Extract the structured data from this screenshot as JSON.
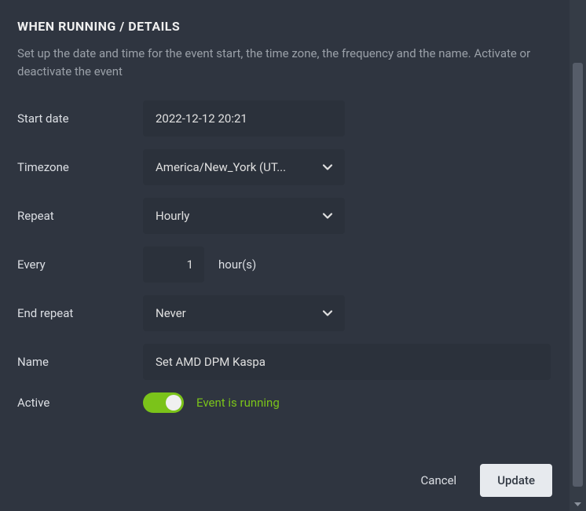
{
  "section": {
    "title": "WHEN RUNNING / DETAILS",
    "description": "Set up the date and time for the event start, the time zone, the frequency and the name. Activate or deactivate the event"
  },
  "form": {
    "start_date": {
      "label": "Start date",
      "value": "2022-12-12 20:21"
    },
    "timezone": {
      "label": "Timezone",
      "value": "America/New_York (UT..."
    },
    "repeat": {
      "label": "Repeat",
      "value": "Hourly"
    },
    "every": {
      "label": "Every",
      "value": "1",
      "suffix": "hour(s)"
    },
    "end_repeat": {
      "label": "End repeat",
      "value": "Never"
    },
    "name": {
      "label": "Name",
      "value": "Set AMD DPM Kaspa"
    },
    "active": {
      "label": "Active",
      "status": "Event is running"
    }
  },
  "actions": {
    "cancel": "Cancel",
    "update": "Update"
  }
}
